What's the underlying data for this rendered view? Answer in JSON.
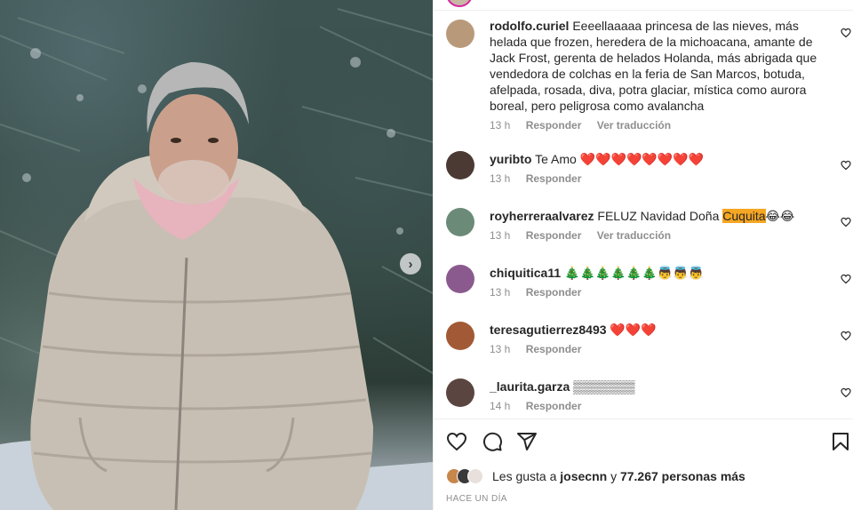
{
  "post": {
    "carousel_next": "›",
    "liked_by_prefix": "Les gusta a ",
    "liked_by_user": "josecnn",
    "liked_by_connector": " y ",
    "liked_by_count": "77.267 personas más",
    "time_ago": "HACE UN DÍA"
  },
  "comments": [
    {
      "username": "rodolfo.curiel",
      "text": "Eeeellaaaaa princesa de las nieves, más helada que frozen, heredera de la michoacana, amante de Jack Frost, gerenta de helados Holanda, más abrigada que vendedora de colchas en la feria de San Marcos, botuda, afelpada, rosada, diva, potra glaciar, mística como aurora boreal, pero peligrosa como avalancha",
      "time": "13 h",
      "reply": "Responder",
      "translate": "Ver traducción",
      "avatar_color": "#b89a7a"
    },
    {
      "username": "yuribto",
      "text": "Te Amo ❤️❤️❤️❤️❤️❤️❤️❤️",
      "time": "13 h",
      "reply": "Responder",
      "avatar_color": "#4a3a33"
    },
    {
      "username": "royherreraalvarez",
      "text_before": "FELUZ Navidad Doña ",
      "text_highlight": "Cuquita",
      "text_after": "😂😂",
      "time": "13 h",
      "reply": "Responder",
      "translate": "Ver traducción",
      "avatar_color": "#6c8a78"
    },
    {
      "username": "chiquitica11",
      "text": "🎄🎄🎄🎄🎄🎄👼👼👼",
      "time": "13 h",
      "reply": "Responder",
      "avatar_color": "#8a5a8f"
    },
    {
      "username": "teresagutierrez8493",
      "text": "❤️❤️❤️",
      "time": "13 h",
      "reply": "Responder",
      "avatar_color": "#a15a35"
    },
    {
      "username": "_laurita.garza",
      "text": "▒▒▒▒▒▒▒",
      "time": "14 h",
      "reply": "Responder",
      "avatar_color": "#5a4540"
    }
  ],
  "icons": {
    "like": "heart-icon",
    "comment": "comment-icon",
    "share": "share-icon",
    "save": "bookmark-icon"
  },
  "colors": {
    "highlight": "#f5a623",
    "secondary_text": "#8e8e8e",
    "story_ring": "#d6249f"
  }
}
